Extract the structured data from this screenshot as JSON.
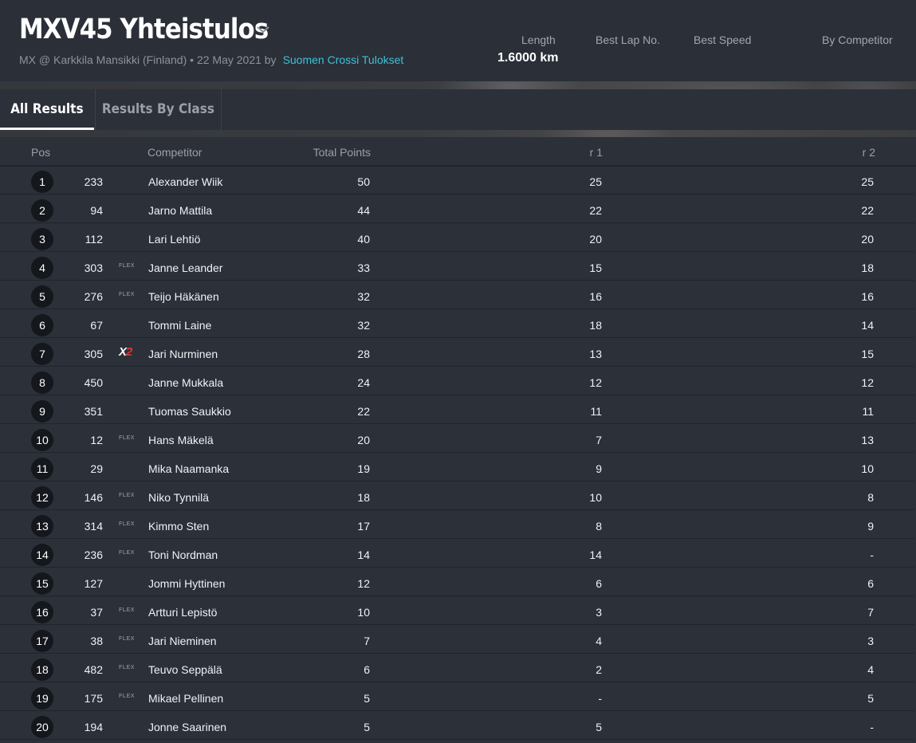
{
  "event": {
    "title": "MXV45 Yhteistulos",
    "subtitle": "MX @ Karkkila Mansikki (Finland) • 22 May 2021 by",
    "organizer": "Suomen Crossi Tulokset"
  },
  "stats": {
    "length_label": "Length",
    "length_value": "1.6000 km",
    "best_lap_label": "Best Lap No.",
    "best_speed_label": "Best Speed",
    "by_competitor_label": "By Competitor"
  },
  "tabs": [
    {
      "label": "All Results",
      "active": true
    },
    {
      "label": "Results By Class",
      "active": false
    }
  ],
  "columns": {
    "pos": "Pos",
    "competitor": "Competitor",
    "total": "Total Points",
    "r1": "r 1",
    "r2": "r 2"
  },
  "results": [
    {
      "pos": "1",
      "num": "233",
      "tag": "",
      "name": "Alexander Wiik",
      "total": "50",
      "r1": "25",
      "r2": "25"
    },
    {
      "pos": "2",
      "num": "94",
      "tag": "",
      "name": "Jarno Mattila",
      "total": "44",
      "r1": "22",
      "r2": "22"
    },
    {
      "pos": "3",
      "num": "112",
      "tag": "",
      "name": "Lari Lehtiö",
      "total": "40",
      "r1": "20",
      "r2": "20"
    },
    {
      "pos": "4",
      "num": "303",
      "tag": "FLEX",
      "name": "Janne Leander",
      "total": "33",
      "r1": "15",
      "r2": "18"
    },
    {
      "pos": "5",
      "num": "276",
      "tag": "FLEX",
      "name": "Teijo Häkänen",
      "total": "32",
      "r1": "16",
      "r2": "16"
    },
    {
      "pos": "6",
      "num": "67",
      "tag": "",
      "name": "Tommi Laine",
      "total": "32",
      "r1": "18",
      "r2": "14"
    },
    {
      "pos": "7",
      "num": "305",
      "tag": "X2",
      "name": "Jari Nurminen",
      "total": "28",
      "r1": "13",
      "r2": "15"
    },
    {
      "pos": "8",
      "num": "450",
      "tag": "",
      "name": "Janne Mukkala",
      "total": "24",
      "r1": "12",
      "r2": "12"
    },
    {
      "pos": "9",
      "num": "351",
      "tag": "",
      "name": "Tuomas Saukkio",
      "total": "22",
      "r1": "11",
      "r2": "11"
    },
    {
      "pos": "10",
      "num": "12",
      "tag": "FLEX",
      "name": "Hans Mäkelä",
      "total": "20",
      "r1": "7",
      "r2": "13"
    },
    {
      "pos": "11",
      "num": "29",
      "tag": "",
      "name": "Mika Naamanka",
      "total": "19",
      "r1": "9",
      "r2": "10"
    },
    {
      "pos": "12",
      "num": "146",
      "tag": "FLEX",
      "name": "Niko Tynnilä",
      "total": "18",
      "r1": "10",
      "r2": "8"
    },
    {
      "pos": "13",
      "num": "314",
      "tag": "FLEX",
      "name": "Kimmo Sten",
      "total": "17",
      "r1": "8",
      "r2": "9"
    },
    {
      "pos": "14",
      "num": "236",
      "tag": "FLEX",
      "name": "Toni Nordman",
      "total": "14",
      "r1": "14",
      "r2": "-"
    },
    {
      "pos": "15",
      "num": "127",
      "tag": "",
      "name": "Jommi Hyttinen",
      "total": "12",
      "r1": "6",
      "r2": "6"
    },
    {
      "pos": "16",
      "num": "37",
      "tag": "FLEX",
      "name": "Artturi Lepistö",
      "total": "10",
      "r1": "3",
      "r2": "7"
    },
    {
      "pos": "17",
      "num": "38",
      "tag": "FLEX",
      "name": "Jari Nieminen",
      "total": "7",
      "r1": "4",
      "r2": "3"
    },
    {
      "pos": "18",
      "num": "482",
      "tag": "FLEX",
      "name": "Teuvo Seppälä",
      "total": "6",
      "r1": "2",
      "r2": "4"
    },
    {
      "pos": "19",
      "num": "175",
      "tag": "FLEX",
      "name": "Mikael Pellinen",
      "total": "5",
      "r1": "-",
      "r2": "5"
    },
    {
      "pos": "20",
      "num": "194",
      "tag": "",
      "name": "Jonne Saarinen",
      "total": "5",
      "r1": "5",
      "r2": "-"
    }
  ],
  "colors": {
    "background": "#2b3039",
    "link": "#3ec1d9",
    "accent_red": "#e2333b"
  }
}
